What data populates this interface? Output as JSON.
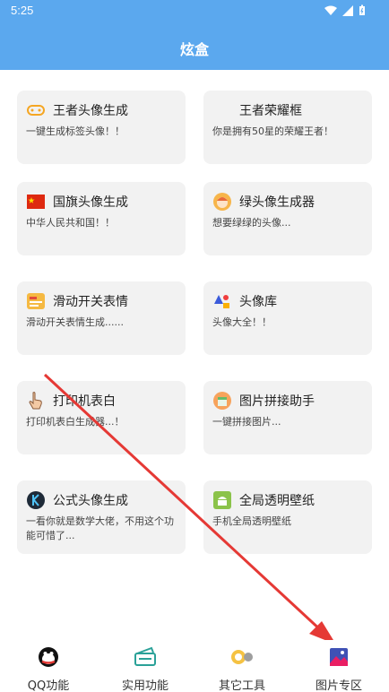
{
  "status_bar": {
    "time": "5:25"
  },
  "header": {
    "title": "炫盒"
  },
  "cards": [
    {
      "title": "王者头像生成",
      "desc": "一键生成标签头像！！"
    },
    {
      "title": "王者荣耀框",
      "desc": "你是拥有50星的荣耀王者！"
    },
    {
      "title": "国旗头像生成",
      "desc": "中华人民共和国！！"
    },
    {
      "title": "绿头像生成器",
      "desc": "想要绿绿的头像..."
    },
    {
      "title": "滑动开关表情",
      "desc": "滑动开关表情生成......"
    },
    {
      "title": "头像库",
      "desc": "头像大全！！"
    },
    {
      "title": "打印机表白",
      "desc": "打印机表白生成器...！"
    },
    {
      "title": "图片拼接助手",
      "desc": "一键拼接图片..."
    },
    {
      "title": "公式头像生成",
      "desc": "一看你就是数学大佬，不用这个功能可惜了..."
    },
    {
      "title": "全局透明壁纸",
      "desc": "手机全局透明壁纸"
    }
  ],
  "tabs": [
    {
      "label": "QQ功能"
    },
    {
      "label": "实用功能"
    },
    {
      "label": "其它工具"
    },
    {
      "label": "图片专区"
    }
  ],
  "colors": {
    "header_bg": "#5ba8ee",
    "card_bg": "#f2f2f2",
    "arrow": "#e53935"
  }
}
